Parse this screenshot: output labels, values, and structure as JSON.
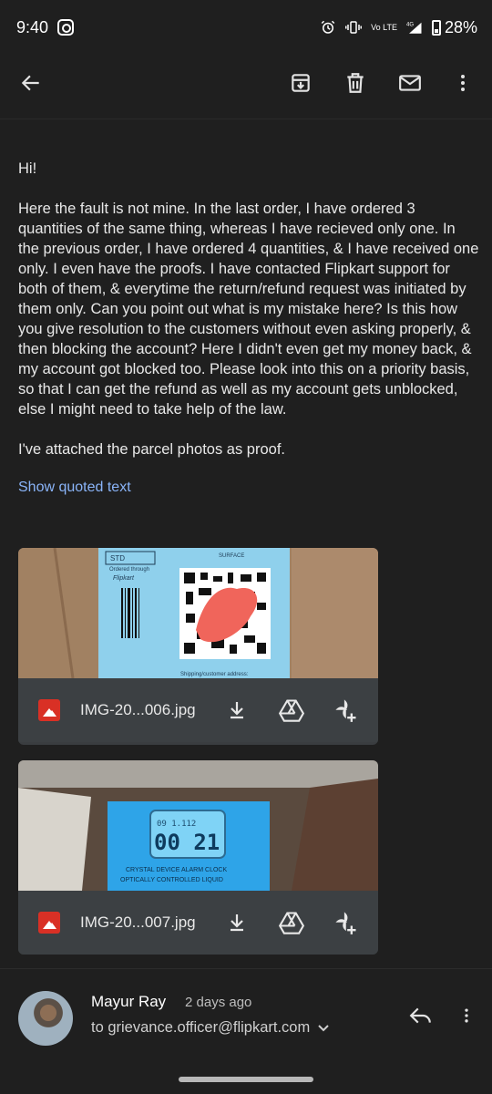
{
  "status_bar": {
    "time": "9:40",
    "network": "Vo LTE",
    "signal": "4G",
    "battery": "28%"
  },
  "toolbar": {
    "icons": [
      "back-arrow-icon",
      "archive-icon",
      "delete-icon",
      "mail-icon",
      "more-vert-icon"
    ]
  },
  "message": {
    "greeting": "Hi!",
    "body": "Here the fault is not mine. In the last order, I have ordered 3 quantities of the same thing, whereas I have recieved only one. In the previous order, I have ordered 4 quantities, & I have received one only. I even have the proofs. I have contacted Flipkart support for both of them, & everytime the return/refund request was initiated by them only. Can you point out what is my mistake here? Is this how you give resolution to the customers without even asking properly, & then blocking the account? Here I didn't even get my money back, & my account got blocked too. Please look into this on a priority basis, so that I can get the refund as well as my account gets unblocked, else I might need to take help of the law.",
    "closing": "I've attached the parcel photos as proof.",
    "show_quoted": "Show quoted text"
  },
  "attachments": [
    {
      "filename": "IMG-20...006.jpg",
      "label_std": "STD",
      "label_surface": "SURFACE",
      "label_ordered": "Ordered through",
      "label_brand": "Flipkart",
      "label_shipping": "Shipping/customer address:"
    },
    {
      "filename": "IMG-20...007.jpg",
      "clock_top": "09  1.112",
      "clock_time": "00 21",
      "clock_caption_1": "CRYSTAL DEVICE ALARM CLOCK",
      "clock_caption_2": "OPTICALLY CONTROLLED LIQUID"
    }
  ],
  "attachment_actions": [
    "download-icon",
    "drive-icon",
    "add-to-photos-icon"
  ],
  "sender": {
    "name": "Mayur Ray",
    "date": "2 days ago",
    "to": "to grievance.officer@flipkart.com"
  },
  "colors": {
    "background": "#1f1f1f",
    "link": "#8ab4f8",
    "attachment_bar": "#3c4043",
    "image_icon": "#d93025"
  }
}
